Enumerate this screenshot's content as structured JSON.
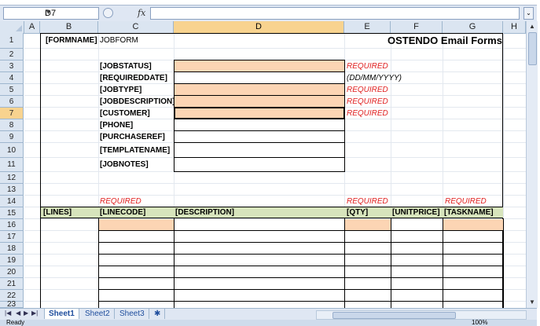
{
  "namebox": {
    "value": "D7"
  },
  "formula_bar": {
    "fx_label": "fx",
    "content": ""
  },
  "columns": [
    "A",
    "B",
    "C",
    "D",
    "E",
    "F",
    "G",
    "H"
  ],
  "selected_column": "D",
  "selected_row": "7",
  "rows": [
    "1",
    "2",
    "3",
    "4",
    "5",
    "6",
    "7",
    "8",
    "9",
    "10",
    "11",
    "12",
    "13",
    "14",
    "15",
    "16",
    "17",
    "18",
    "19",
    "20",
    "21",
    "22",
    "23"
  ],
  "header_row": {
    "formname_label": "[FORMNAME]",
    "formname_value": "JOBFORM",
    "title": "OSTENDO Email Forms"
  },
  "fields": [
    {
      "label": "[JOBSTATUS]",
      "note": "REQUIRED"
    },
    {
      "label": "[REQUIREDDATE]",
      "note": "(DD/MM/YYYY)"
    },
    {
      "label": "[JOBTYPE]",
      "note": "REQUIRED"
    },
    {
      "label": "[JOBDESCRIPTION]",
      "note": "REQUIRED"
    },
    {
      "label": "[CUSTOMER]",
      "note": "REQUIRED"
    },
    {
      "label": "[PHONE]",
      "note": ""
    },
    {
      "label": "[PURCHASEREF]",
      "note": ""
    },
    {
      "label": "[TEMPLATENAME]",
      "note": ""
    },
    {
      "label": "[JOBNOTES]",
      "note": ""
    }
  ],
  "required_row": {
    "c": "REQUIRED",
    "e": "REQUIRED",
    "g": "REQUIRED"
  },
  "lines_header": {
    "b": "[LINES]",
    "c": "[LINECODE]",
    "d": "[DESCRIPTION]",
    "e": "[QTY]",
    "f": "[UNITPRICE]",
    "g": "[TASKNAME]"
  },
  "sheets": [
    "Sheet1",
    "Sheet2",
    "Sheet3"
  ],
  "active_sheet": "Sheet1",
  "status": {
    "left": "Ready",
    "zoom": "100%"
  },
  "colors": {
    "required": "#e02020",
    "peach": "#fcd5b4",
    "green": "#d7e4bc",
    "header_bg": "#dbe5f1",
    "selected_header": "#f8d38f"
  }
}
